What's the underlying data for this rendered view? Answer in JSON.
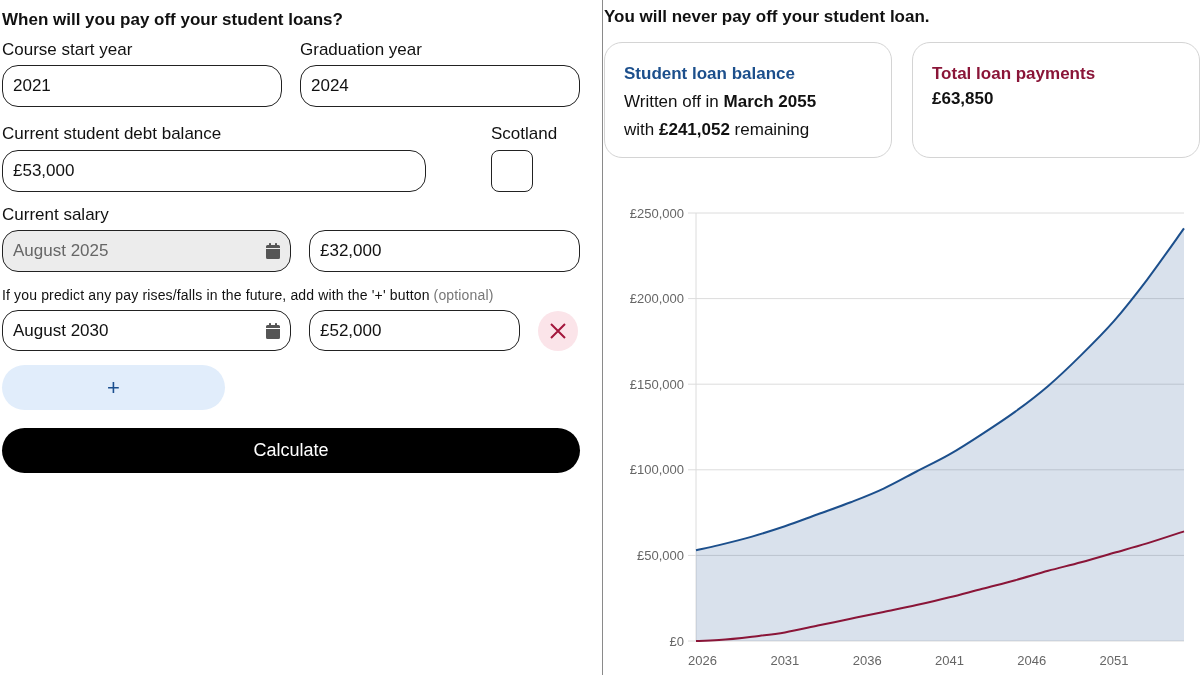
{
  "form": {
    "title": "When will you pay off your student loans?",
    "course_start": {
      "label": "Course start year",
      "value": "2021"
    },
    "graduation": {
      "label": "Graduation year",
      "value": "2024"
    },
    "debt_balance": {
      "label": "Current student debt balance",
      "value": "£53,000"
    },
    "scotland": {
      "label": "Scotland",
      "checked": false
    },
    "current_salary": {
      "label": "Current salary",
      "date": {
        "value": "August 2025",
        "disabled": true
      },
      "amount": {
        "value": "£32,000"
      }
    },
    "hint": {
      "text": "If you predict any pay rises/falls in the future, add with the '+' button",
      "note": "(optional)"
    },
    "pay_changes": [
      {
        "date": {
          "value": "August 2030",
          "disabled": false
        },
        "amount": {
          "value": "£52,000"
        }
      }
    ],
    "add_button": {
      "label": "+"
    },
    "calculate_button": {
      "label": "Calculate"
    }
  },
  "results": {
    "headline": "You will never pay off your student loan.",
    "cards": [
      {
        "title": "Student loan balance",
        "color": "#1c4f8c",
        "lines": [
          "Written off in **March 2055**",
          "with **£241,052** remaining"
        ]
      },
      {
        "title": "Total loan payments",
        "color": "#8a1538",
        "value": "£63,850"
      }
    ],
    "chart_data": {
      "type": "area",
      "x": [
        2025.6,
        2027,
        2029,
        2031,
        2033,
        2035,
        2037,
        2039,
        2041,
        2043,
        2045,
        2047,
        2049,
        2051,
        2053,
        2055.25
      ],
      "series": [
        {
          "color": "#1c4f8c",
          "values": [
            53000,
            56000,
            61000,
            67000,
            74000,
            81000,
            89000,
            99000,
            109000,
            121000,
            134000,
            149000,
            167000,
            187000,
            211000,
            241000
          ]
        },
        {
          "type": "line",
          "color": "#8a1538",
          "values": [
            0,
            500,
            2500,
            5000,
            9000,
            13000,
            17000,
            21000,
            25500,
            30500,
            35500,
            41000,
            46000,
            51500,
            57000,
            64000
          ]
        }
      ],
      "xlim": [
        2025.6,
        2055.25
      ],
      "ylim": [
        0,
        250000
      ],
      "xticks": [
        2026,
        2031,
        2036,
        2041,
        2046,
        2051
      ],
      "yticks": [
        {
          "value": 0,
          "label": "£0"
        },
        {
          "value": 50000,
          "label": "£50,000"
        },
        {
          "value": 100000,
          "label": "£100,000"
        },
        {
          "value": 150000,
          "label": "£150,000"
        },
        {
          "value": 200000,
          "label": "£200,000"
        },
        {
          "value": 250000,
          "label": "£250,000"
        }
      ],
      "grid": true
    }
  }
}
